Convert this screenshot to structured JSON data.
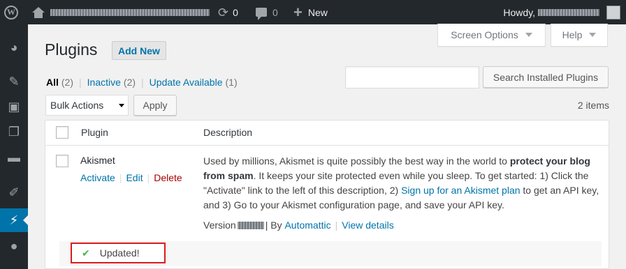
{
  "adminbar": {
    "updates_count": "0",
    "comments_count": "0",
    "new_label": "New",
    "howdy_label": "Howdy,"
  },
  "sidebar": {
    "icons": [
      "dashboard-icon",
      "posts-icon",
      "media-icon",
      "pages-icon",
      "comments-icon",
      "appearance-icon",
      "plugins-icon",
      "users-icon"
    ],
    "active": "plugins-icon",
    "active_color": "#0073aa"
  },
  "tabs": {
    "screen_options": "Screen Options",
    "help": "Help"
  },
  "header": {
    "title": "Plugins",
    "add_new": "Add New"
  },
  "filters": {
    "all_label": "All",
    "all_count": "(2)",
    "inactive_label": "Inactive",
    "inactive_count": "(2)",
    "update_label": "Update Available",
    "update_count": "(1)"
  },
  "search": {
    "placeholder": "",
    "button": "Search Installed Plugins"
  },
  "bulk": {
    "selected": "Bulk Actions",
    "apply": "Apply",
    "items_count": "2 items"
  },
  "table": {
    "columns": [
      "Plugin",
      "Description"
    ],
    "rows": [
      {
        "name": "Akismet",
        "actions": [
          "Activate",
          "Edit",
          "Delete"
        ],
        "desc_1": "Used by millions, Akismet is quite possibly the best way in the world to ",
        "desc_bold": "protect your blog from spam",
        "desc_2": ". It keeps your site protected even while you sleep. To get started: 1) Click the \"Activate\" link to the left of this description, 2) ",
        "desc_link": "Sign up for an Akismet plan",
        "desc_3": " to get an API key, and 3) Go to your Akismet configuration page, and save your API key.",
        "version_label": "Version",
        "by_label": "| By",
        "author": "Automattic",
        "details": "View details"
      }
    ]
  },
  "notice": {
    "text": "Updated!",
    "check_color": "#46b450",
    "highlight_color": "#dd1a1a"
  }
}
